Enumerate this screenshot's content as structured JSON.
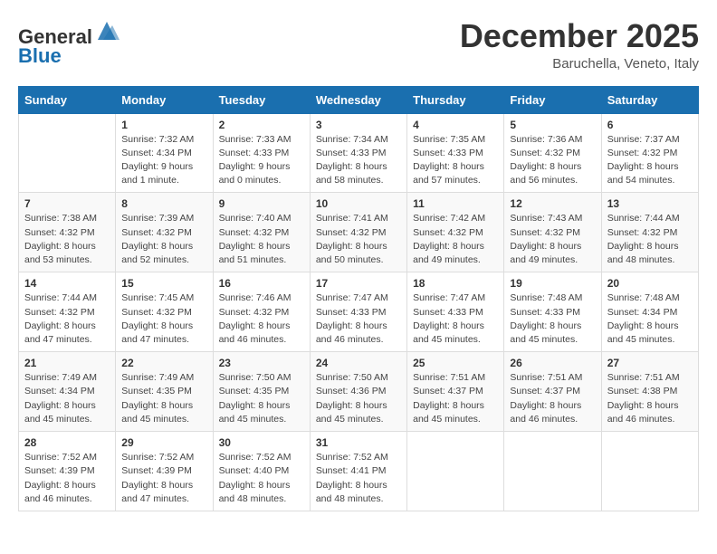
{
  "header": {
    "logo_line1": "General",
    "logo_line2": "Blue",
    "month": "December 2025",
    "location": "Baruchella, Veneto, Italy"
  },
  "weekdays": [
    "Sunday",
    "Monday",
    "Tuesday",
    "Wednesday",
    "Thursday",
    "Friday",
    "Saturday"
  ],
  "weeks": [
    [
      {
        "day": "",
        "sunrise": "",
        "sunset": "",
        "daylight": ""
      },
      {
        "day": "1",
        "sunrise": "Sunrise: 7:32 AM",
        "sunset": "Sunset: 4:34 PM",
        "daylight": "Daylight: 9 hours and 1 minute."
      },
      {
        "day": "2",
        "sunrise": "Sunrise: 7:33 AM",
        "sunset": "Sunset: 4:33 PM",
        "daylight": "Daylight: 9 hours and 0 minutes."
      },
      {
        "day": "3",
        "sunrise": "Sunrise: 7:34 AM",
        "sunset": "Sunset: 4:33 PM",
        "daylight": "Daylight: 8 hours and 58 minutes."
      },
      {
        "day": "4",
        "sunrise": "Sunrise: 7:35 AM",
        "sunset": "Sunset: 4:33 PM",
        "daylight": "Daylight: 8 hours and 57 minutes."
      },
      {
        "day": "5",
        "sunrise": "Sunrise: 7:36 AM",
        "sunset": "Sunset: 4:32 PM",
        "daylight": "Daylight: 8 hours and 56 minutes."
      },
      {
        "day": "6",
        "sunrise": "Sunrise: 7:37 AM",
        "sunset": "Sunset: 4:32 PM",
        "daylight": "Daylight: 8 hours and 54 minutes."
      }
    ],
    [
      {
        "day": "7",
        "sunrise": "Sunrise: 7:38 AM",
        "sunset": "Sunset: 4:32 PM",
        "daylight": "Daylight: 8 hours and 53 minutes."
      },
      {
        "day": "8",
        "sunrise": "Sunrise: 7:39 AM",
        "sunset": "Sunset: 4:32 PM",
        "daylight": "Daylight: 8 hours and 52 minutes."
      },
      {
        "day": "9",
        "sunrise": "Sunrise: 7:40 AM",
        "sunset": "Sunset: 4:32 PM",
        "daylight": "Daylight: 8 hours and 51 minutes."
      },
      {
        "day": "10",
        "sunrise": "Sunrise: 7:41 AM",
        "sunset": "Sunset: 4:32 PM",
        "daylight": "Daylight: 8 hours and 50 minutes."
      },
      {
        "day": "11",
        "sunrise": "Sunrise: 7:42 AM",
        "sunset": "Sunset: 4:32 PM",
        "daylight": "Daylight: 8 hours and 49 minutes."
      },
      {
        "day": "12",
        "sunrise": "Sunrise: 7:43 AM",
        "sunset": "Sunset: 4:32 PM",
        "daylight": "Daylight: 8 hours and 49 minutes."
      },
      {
        "day": "13",
        "sunrise": "Sunrise: 7:44 AM",
        "sunset": "Sunset: 4:32 PM",
        "daylight": "Daylight: 8 hours and 48 minutes."
      }
    ],
    [
      {
        "day": "14",
        "sunrise": "Sunrise: 7:44 AM",
        "sunset": "Sunset: 4:32 PM",
        "daylight": "Daylight: 8 hours and 47 minutes."
      },
      {
        "day": "15",
        "sunrise": "Sunrise: 7:45 AM",
        "sunset": "Sunset: 4:32 PM",
        "daylight": "Daylight: 8 hours and 47 minutes."
      },
      {
        "day": "16",
        "sunrise": "Sunrise: 7:46 AM",
        "sunset": "Sunset: 4:32 PM",
        "daylight": "Daylight: 8 hours and 46 minutes."
      },
      {
        "day": "17",
        "sunrise": "Sunrise: 7:47 AM",
        "sunset": "Sunset: 4:33 PM",
        "daylight": "Daylight: 8 hours and 46 minutes."
      },
      {
        "day": "18",
        "sunrise": "Sunrise: 7:47 AM",
        "sunset": "Sunset: 4:33 PM",
        "daylight": "Daylight: 8 hours and 45 minutes."
      },
      {
        "day": "19",
        "sunrise": "Sunrise: 7:48 AM",
        "sunset": "Sunset: 4:33 PM",
        "daylight": "Daylight: 8 hours and 45 minutes."
      },
      {
        "day": "20",
        "sunrise": "Sunrise: 7:48 AM",
        "sunset": "Sunset: 4:34 PM",
        "daylight": "Daylight: 8 hours and 45 minutes."
      }
    ],
    [
      {
        "day": "21",
        "sunrise": "Sunrise: 7:49 AM",
        "sunset": "Sunset: 4:34 PM",
        "daylight": "Daylight: 8 hours and 45 minutes."
      },
      {
        "day": "22",
        "sunrise": "Sunrise: 7:49 AM",
        "sunset": "Sunset: 4:35 PM",
        "daylight": "Daylight: 8 hours and 45 minutes."
      },
      {
        "day": "23",
        "sunrise": "Sunrise: 7:50 AM",
        "sunset": "Sunset: 4:35 PM",
        "daylight": "Daylight: 8 hours and 45 minutes."
      },
      {
        "day": "24",
        "sunrise": "Sunrise: 7:50 AM",
        "sunset": "Sunset: 4:36 PM",
        "daylight": "Daylight: 8 hours and 45 minutes."
      },
      {
        "day": "25",
        "sunrise": "Sunrise: 7:51 AM",
        "sunset": "Sunset: 4:37 PM",
        "daylight": "Daylight: 8 hours and 45 minutes."
      },
      {
        "day": "26",
        "sunrise": "Sunrise: 7:51 AM",
        "sunset": "Sunset: 4:37 PM",
        "daylight": "Daylight: 8 hours and 46 minutes."
      },
      {
        "day": "27",
        "sunrise": "Sunrise: 7:51 AM",
        "sunset": "Sunset: 4:38 PM",
        "daylight": "Daylight: 8 hours and 46 minutes."
      }
    ],
    [
      {
        "day": "28",
        "sunrise": "Sunrise: 7:52 AM",
        "sunset": "Sunset: 4:39 PM",
        "daylight": "Daylight: 8 hours and 46 minutes."
      },
      {
        "day": "29",
        "sunrise": "Sunrise: 7:52 AM",
        "sunset": "Sunset: 4:39 PM",
        "daylight": "Daylight: 8 hours and 47 minutes."
      },
      {
        "day": "30",
        "sunrise": "Sunrise: 7:52 AM",
        "sunset": "Sunset: 4:40 PM",
        "daylight": "Daylight: 8 hours and 48 minutes."
      },
      {
        "day": "31",
        "sunrise": "Sunrise: 7:52 AM",
        "sunset": "Sunset: 4:41 PM",
        "daylight": "Daylight: 8 hours and 48 minutes."
      },
      {
        "day": "",
        "sunrise": "",
        "sunset": "",
        "daylight": ""
      },
      {
        "day": "",
        "sunrise": "",
        "sunset": "",
        "daylight": ""
      },
      {
        "day": "",
        "sunrise": "",
        "sunset": "",
        "daylight": ""
      }
    ]
  ]
}
